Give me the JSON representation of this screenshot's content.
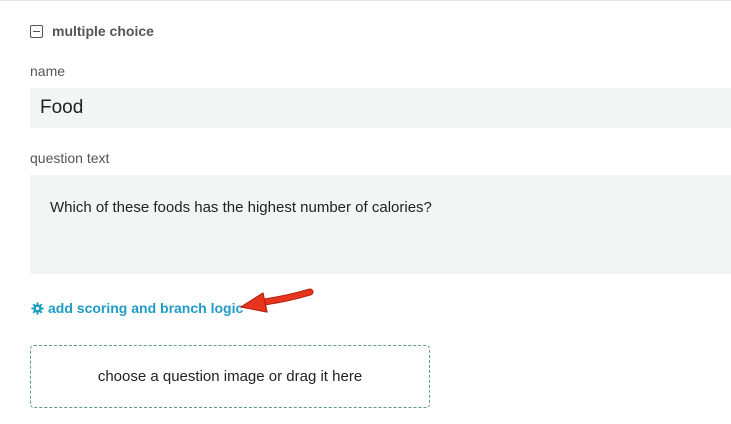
{
  "section": {
    "title": "multiple choice",
    "collapse_icon": "minus-square-icon"
  },
  "name_field": {
    "label": "name",
    "value": "Food"
  },
  "question_field": {
    "label": "question text",
    "value": "Which of these foods has the highest number of calories?"
  },
  "logic_link": {
    "icon": "gear-icon",
    "label": "add scoring and branch logic",
    "color": "#1f9cc4"
  },
  "annotation": {
    "icon": "red-arrow-icon",
    "color": "#e8341c"
  },
  "dropzone": {
    "label": "choose a question image or drag it here"
  }
}
